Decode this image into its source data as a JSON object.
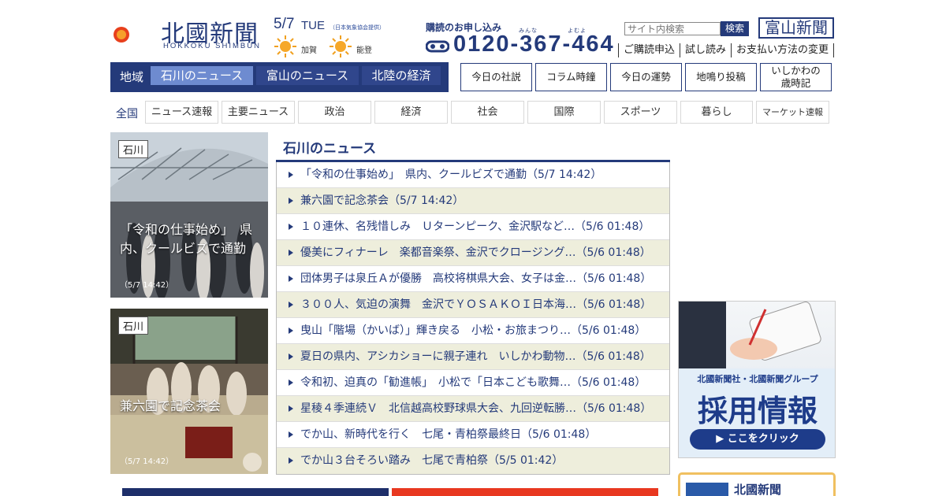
{
  "header": {
    "logo_name": "北國新聞",
    "logo_sub": "HOKKOKU SHIMBUN",
    "date": "5/7",
    "dow": "TUE",
    "weather_credit": "（日本気象協会提供）",
    "weather": [
      {
        "city": "加賀",
        "icon": "sun-icon"
      },
      {
        "city": "能登",
        "icon": "sun-icon"
      }
    ],
    "subscribe_title": "購読のお申し込み",
    "subscribe_ruby": [
      "みんな",
      "よむよ"
    ],
    "phone": "0120-367-464",
    "search_placeholder": "サイト内検索",
    "search_button": "検索",
    "toyama_label": "富山新聞",
    "top_links": [
      "ご購読申込",
      "試し読み",
      "お支払い方法の変更"
    ]
  },
  "nav": {
    "region_label": "地域",
    "tabs": [
      "石川のニュース",
      "富山のニュース",
      "北陸の経済"
    ],
    "boxes": [
      "今日の社説",
      "コラム時鐘",
      "今日の運勢",
      "地鳴り投稿",
      "いしかわの\n歳時記"
    ]
  },
  "categories": {
    "label": "全国",
    "items": [
      "ニュース速報",
      "主要ニュース",
      "政治",
      "経済",
      "社会",
      "国際",
      "スポーツ",
      "暮らし",
      "マーケット速報"
    ]
  },
  "photos": [
    {
      "tag": "石川",
      "caption": "「令和の仕事始め」　県内、クールビズで通勤",
      "time": "（5/7 14:42）"
    },
    {
      "tag": "石川",
      "caption": "兼六園で記念茶会",
      "time": "（5/7 14:42）"
    }
  ],
  "news": {
    "title": "石川のニュース",
    "items": [
      "「令和の仕事始め」　県内、クールビズで通勤（5/7 14:42）",
      "兼六園で記念茶会（5/7 14:42）",
      "１０連休、名残惜しみ　Ｕターンピーク、金沢駅など…（5/6 01:48）",
      "優美にフィナーレ　楽都音楽祭、金沢でクロージング…（5/6 01:48）",
      "団体男子は泉丘Ａが優勝　高校将棋県大会、女子は金…（5/6 01:48）",
      "３００人、気迫の演舞　金沢でＹＯＳＡＫＯＩ日本海…（5/6 01:48）",
      "曳山「階場（かいば）」輝き戻る　小松・お旅まつり…（5/6 01:48）",
      "夏日の県内、アシカショーに親子連れ　いしかわ動物…（5/6 01:48）",
      "令和初、迫真の「勧進帳」　小松で「日本こども歌舞…（5/6 01:48）",
      "星稜４季連続Ｖ　北信越高校野球県大会、九回逆転勝…（5/6 01:48）",
      "でか山、新時代を行く　七尾・青柏祭最終日（5/6 01:48）",
      "でか山３台そろい踏み　七尾で青柏祭（5/5 01:42）"
    ]
  },
  "ad": {
    "line1": "北國新聞社・北國新聞グループ",
    "line2": "採用情報",
    "button": "ここをクリック"
  },
  "ad2": {
    "label": "北國新聞"
  },
  "colors": {
    "brand": "#243a7a",
    "accent": "#6e8bd0",
    "alt_row": "#eeeedc"
  }
}
